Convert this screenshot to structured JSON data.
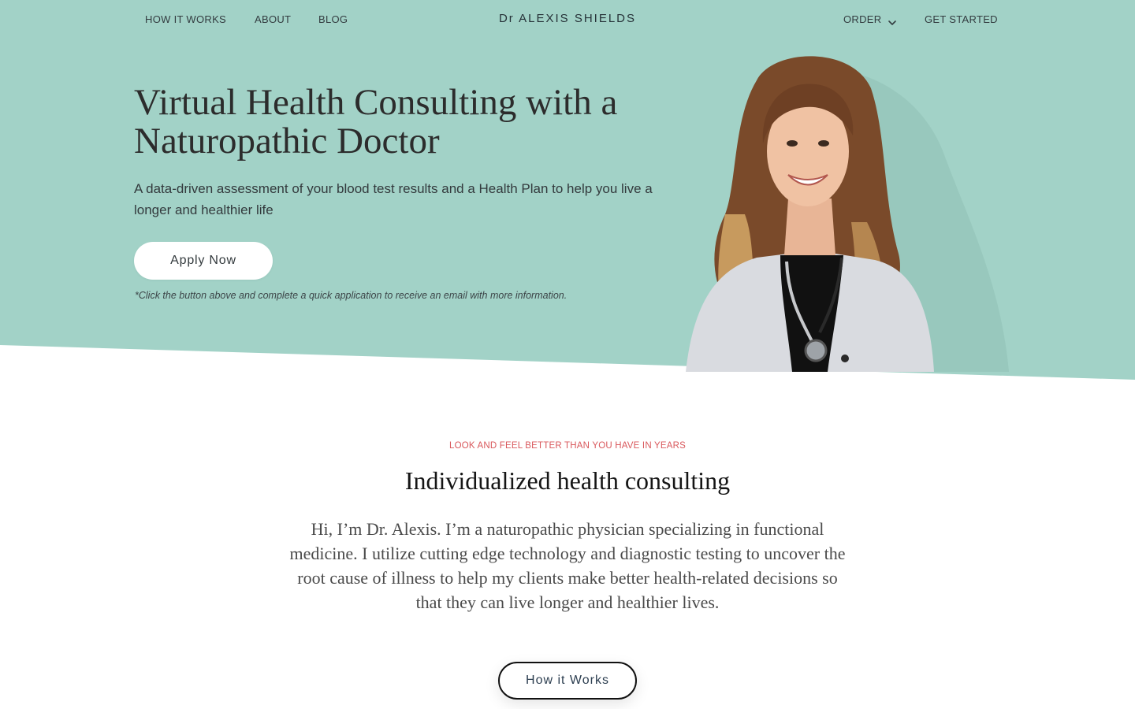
{
  "nav": {
    "left_items": [
      {
        "label": "HOW IT WORKS"
      },
      {
        "label": "ABOUT"
      },
      {
        "label": "BLOG"
      }
    ],
    "brand": "Dr ALEXIS SHIELDS",
    "order_label": "ORDER",
    "get_started_label": "GET STARTED"
  },
  "hero": {
    "title": "Virtual Health Consulting with a Naturopathic Doctor",
    "subtitle": "A data-driven assessment of your blood test results and a Health Plan to help you live a longer and healthier life",
    "cta_label": "Apply Now",
    "note": "*Click the button above and complete a quick application to receive an email with more information."
  },
  "intro": {
    "eyebrow": "LOOK AND FEEL BETTER THAN YOU HAVE IN YEARS",
    "title": "Individualized health consulting",
    "body": "Hi, I’m Dr. Alexis. I’m a naturopathic physician specializing in functional medicine. I utilize cutting edge technology and diagnostic testing to uncover the root cause of illness to help my clients make better health-related decisions so that they can live longer and healthier lives.",
    "cta_label": "How it Works"
  },
  "icons": {
    "order_dropdown": "chevron-down-icon"
  },
  "colors": {
    "hero_bg": "#a2d2c7",
    "eyebrow": "#d9585c",
    "button_bg": "#ffffff"
  }
}
